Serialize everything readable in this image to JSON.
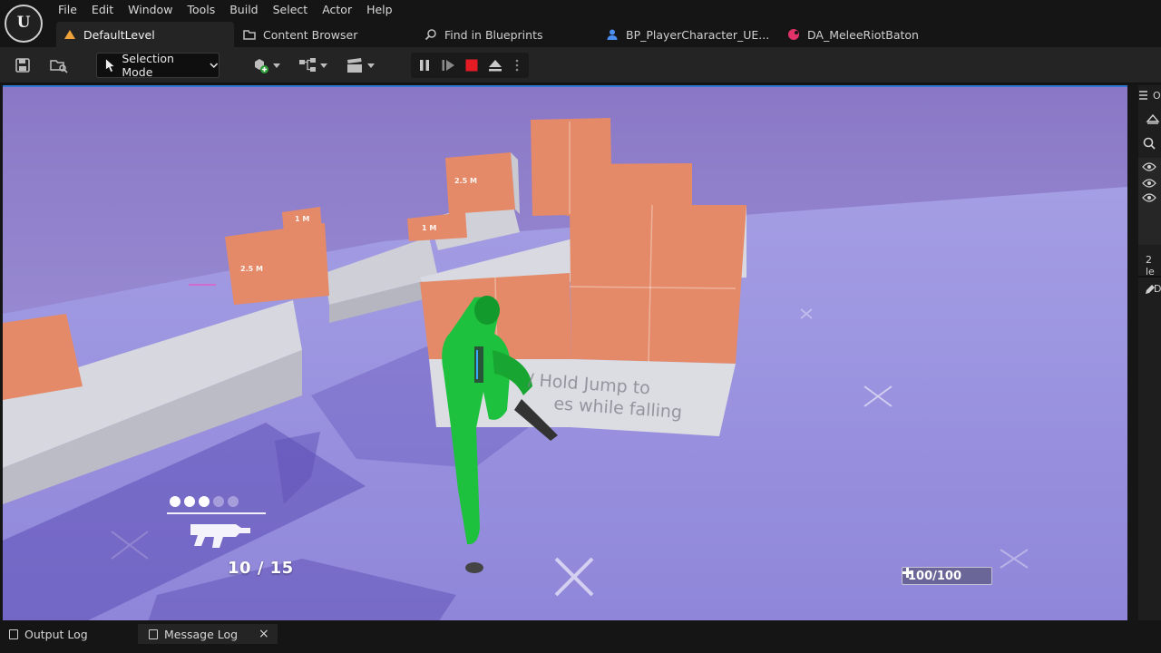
{
  "menu": {
    "items": [
      "File",
      "Edit",
      "Window",
      "Tools",
      "Build",
      "Select",
      "Actor",
      "Help"
    ]
  },
  "tabs": [
    {
      "label": "DefaultLevel",
      "icon": "level-icon",
      "active": true
    },
    {
      "label": "Content Browser",
      "icon": "folder-icon",
      "active": false
    },
    {
      "label": "Find in Blueprints",
      "icon": "find-icon",
      "active": false
    },
    {
      "label": "BP_PlayerCharacter_UE...",
      "icon": "blueprint-icon",
      "active": false
    },
    {
      "label": "DA_MeleeRiotBaton",
      "icon": "data-asset-icon",
      "active": false
    }
  ],
  "toolbar": {
    "selection_mode_label": "Selection Mode",
    "play_controls": [
      "pause-icon",
      "frame-skip-icon",
      "stop-icon",
      "eject-icon"
    ]
  },
  "viewport": {
    "box_labels": [
      "2.5 M",
      "1 M",
      "1 M",
      "2.5 M"
    ],
    "hint_text": "/ Hold Jump to\n     es while falling",
    "ammo": "10 / 15",
    "health": "100/100",
    "grenade_count": 5,
    "grenades_filled": 3
  },
  "right_panel": {
    "count_text": "2 le",
    "label_o": "O",
    "label_d": "D"
  },
  "bottom": {
    "output_log_label": "Output Log",
    "message_log_label": "Message Log",
    "close_glyph": "×"
  },
  "colors": {
    "accent": "#2f7ad1",
    "viewport_floor": "#a49ee4",
    "box_orange": "#e48a68",
    "character_green": "#1ec13d",
    "stop_red": "#e51b23",
    "level_tab_icon": "#f0a23a",
    "bp_tab_icon": "#4a8ef0",
    "da_tab_icon": "#e0336a"
  }
}
